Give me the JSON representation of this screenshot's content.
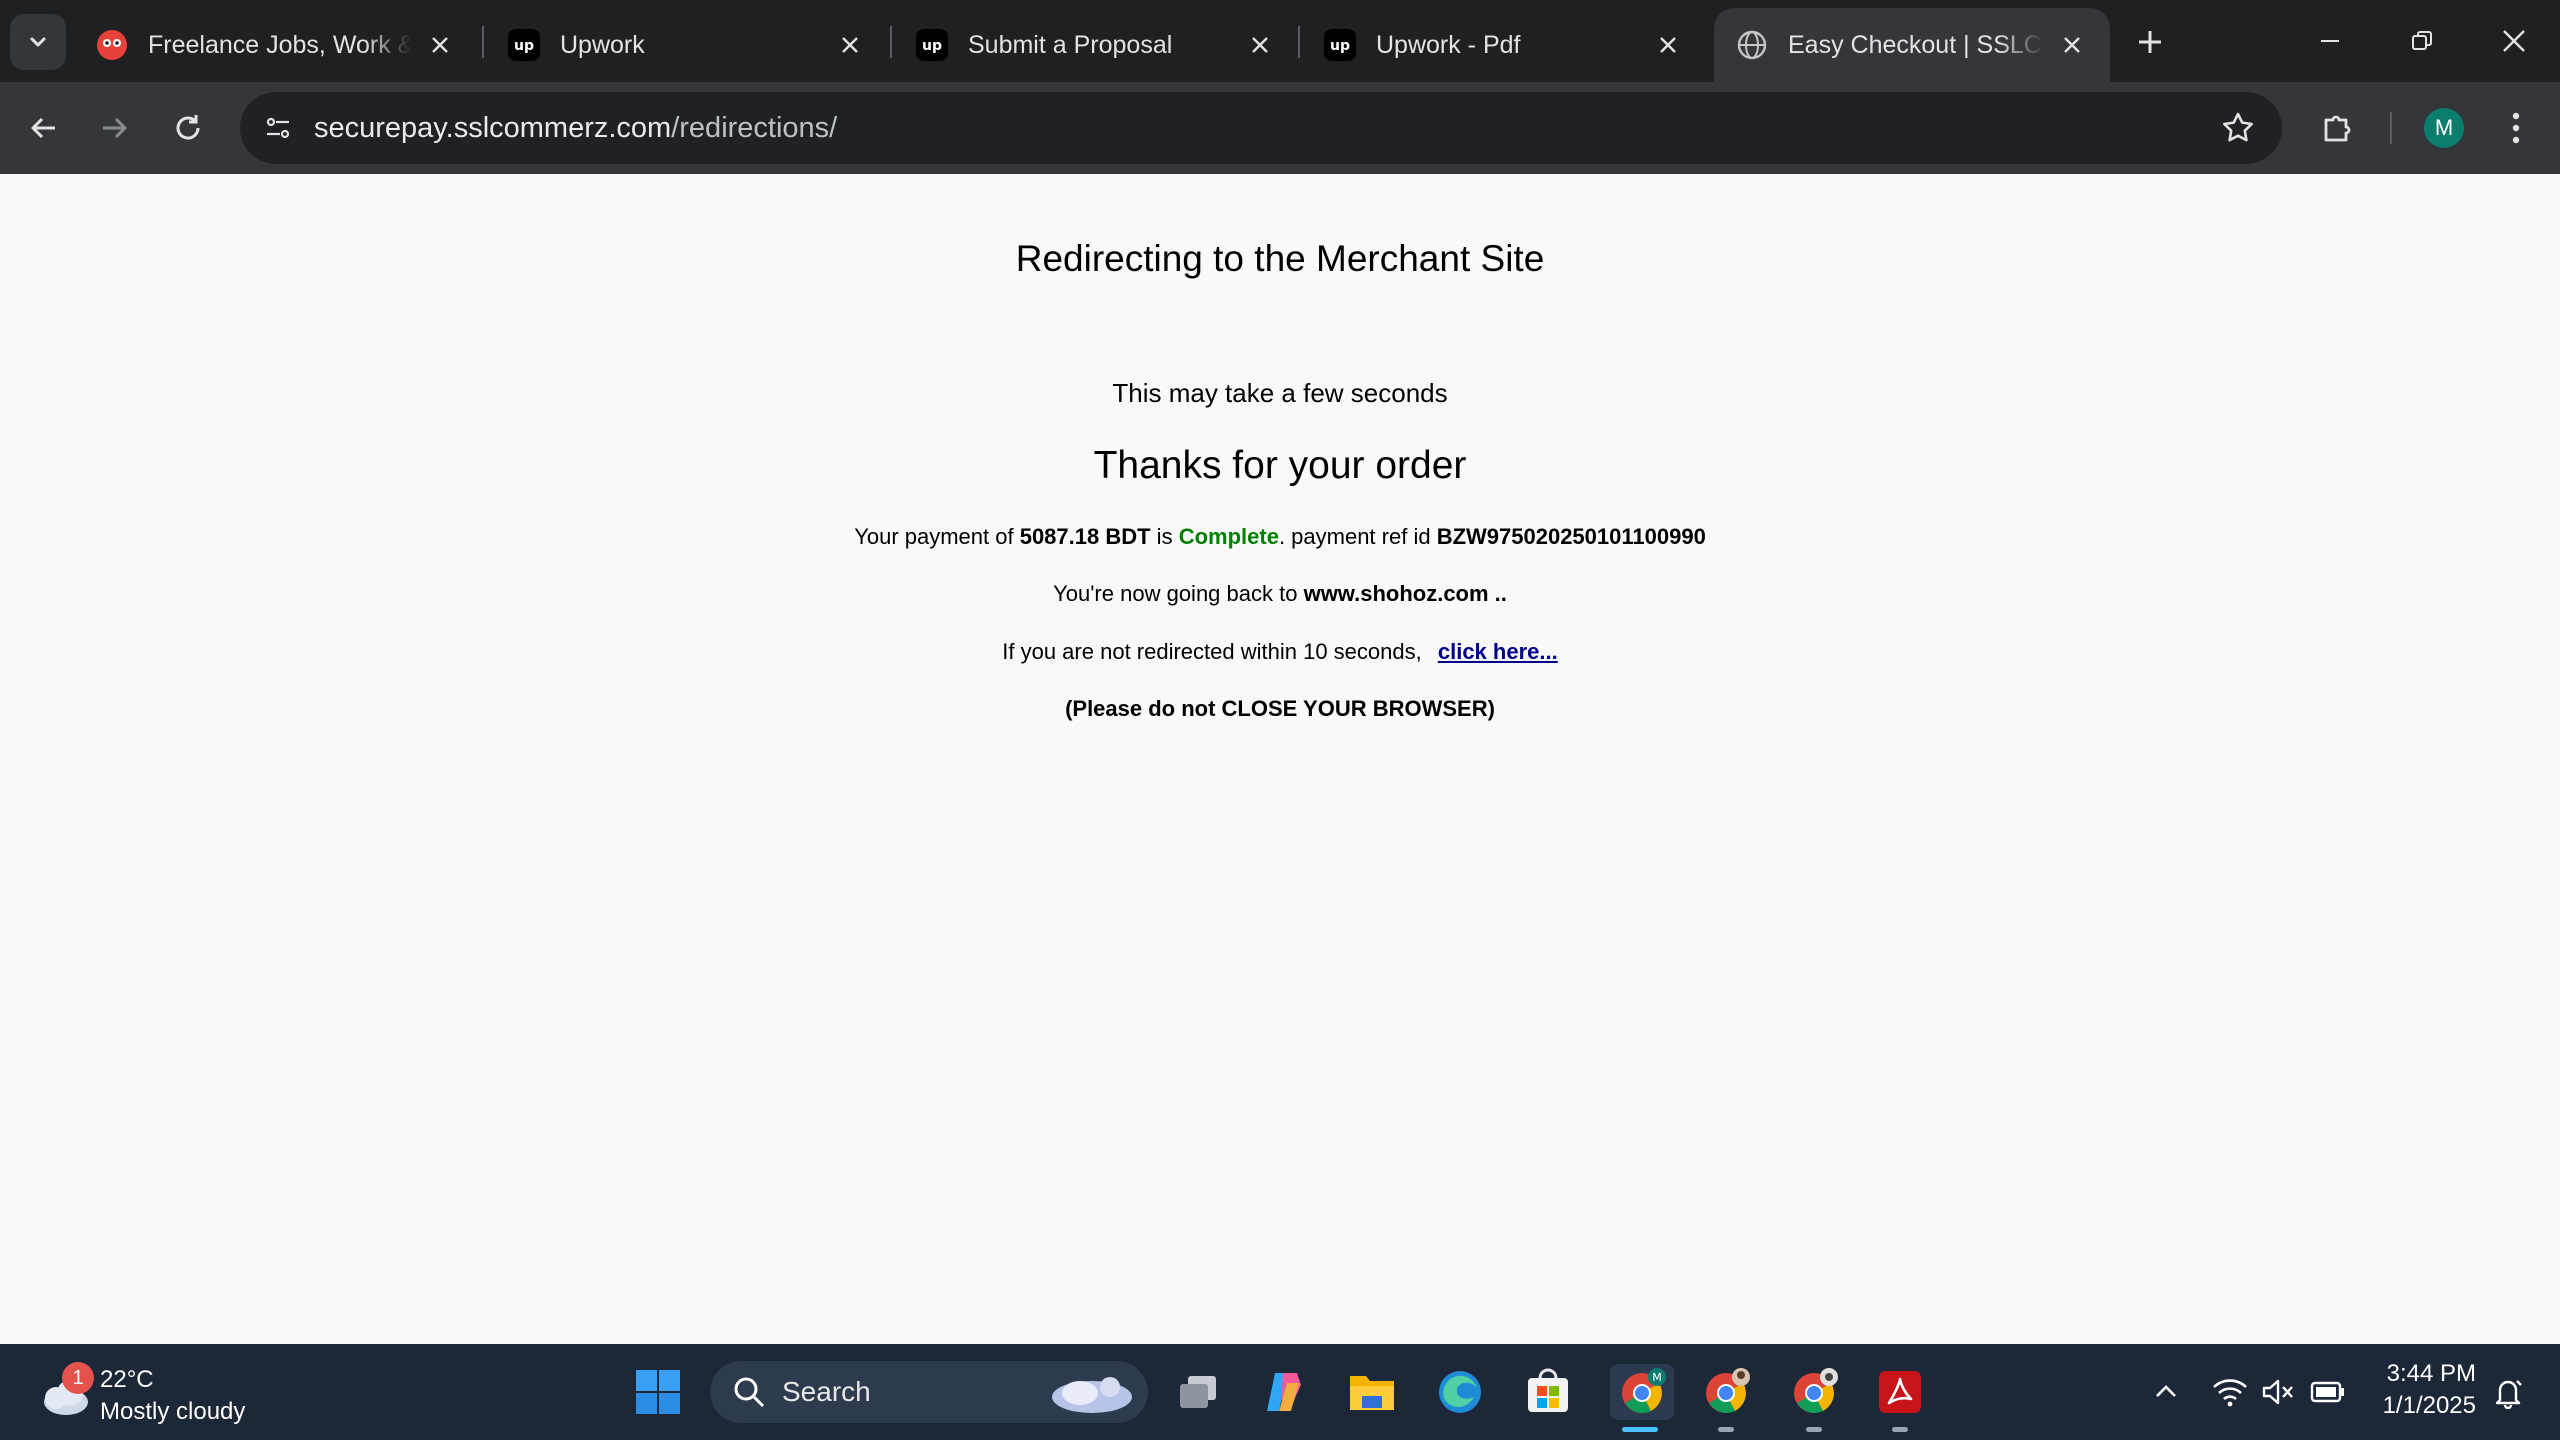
{
  "browser": {
    "tabs": [
      {
        "title": "Freelance Jobs, Work & Projects",
        "favicon": "red-face-icon"
      },
      {
        "title": "Upwork",
        "favicon": "upwork-icon"
      },
      {
        "title": "Submit a Proposal",
        "favicon": "upwork-icon"
      },
      {
        "title": "Upwork - Pdf",
        "favicon": "upwork-icon"
      },
      {
        "title": "Easy Checkout | SSLCOMMERZ",
        "favicon": "globe-icon",
        "active": true
      }
    ],
    "url_host": "securepay.sslcommerz.com",
    "url_path": "/redirections/",
    "profile_initial": "M"
  },
  "page": {
    "heading": "Redirecting to the Merchant Site",
    "sub": "This may take a few seconds",
    "thanks": "Thanks for your order",
    "payment": {
      "prefix": "Your payment of ",
      "amount": "5087.18 BDT",
      "is": " is ",
      "status": "Complete",
      "ref_label": ". payment ref id ",
      "ref_id": "BZW975020250101100990"
    },
    "going_back": {
      "prefix": "You're now going back to ",
      "site": "www.shohoz.com ..",
      "suffix": ""
    },
    "redirect": {
      "text": "If you are not redirected within 10 seconds,",
      "link": "click here..."
    },
    "warning": "(Please do not CLOSE YOUR BROWSER)"
  },
  "taskbar": {
    "weather_badge": "1",
    "temperature": "22°C",
    "condition": "Mostly cloudy",
    "search_label": "Search",
    "time": "3:44 PM",
    "date": "1/1/2025"
  },
  "colors": {
    "complete": "#008000",
    "link": "#00008b",
    "taskbar": "#1c2738",
    "chrome_bg": "#1e2021"
  }
}
